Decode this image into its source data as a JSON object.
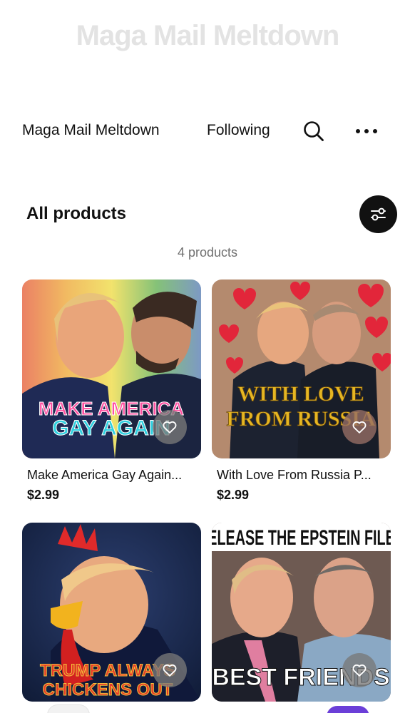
{
  "shop": {
    "banner_title": "Maga Mail Meltdown",
    "name": "Maga Mail Meltdown",
    "follow_label": "Following"
  },
  "icons": {
    "search": "search-icon",
    "more": "more-dots-icon",
    "filter": "filter-sliders-icon",
    "favorite": "heart-icon"
  },
  "section": {
    "title": "All products",
    "count_label": "4 products"
  },
  "products": [
    {
      "title": "Make America Gay Again...",
      "price": "$2.99",
      "image_caption": [
        "MAKE AMERICA",
        "GAY AGAIN"
      ]
    },
    {
      "title": "With Love From Russia P...",
      "price": "$2.99",
      "image_caption": [
        "WITH LOVE",
        "FROM RUSSIA"
      ]
    },
    {
      "title": "",
      "price": "",
      "image_caption": [
        "TRUMP ALWAYS",
        "CHICKENS OUT"
      ]
    },
    {
      "title": "",
      "price": "",
      "image_caption": [
        "RELEASE THE EPSTEIN FILES",
        "BEST FRIENDS"
      ]
    }
  ],
  "colors": {
    "filter_button": "#111111",
    "muted_text": "#6f6f6f",
    "accent_purple": "#6b3fd8"
  }
}
